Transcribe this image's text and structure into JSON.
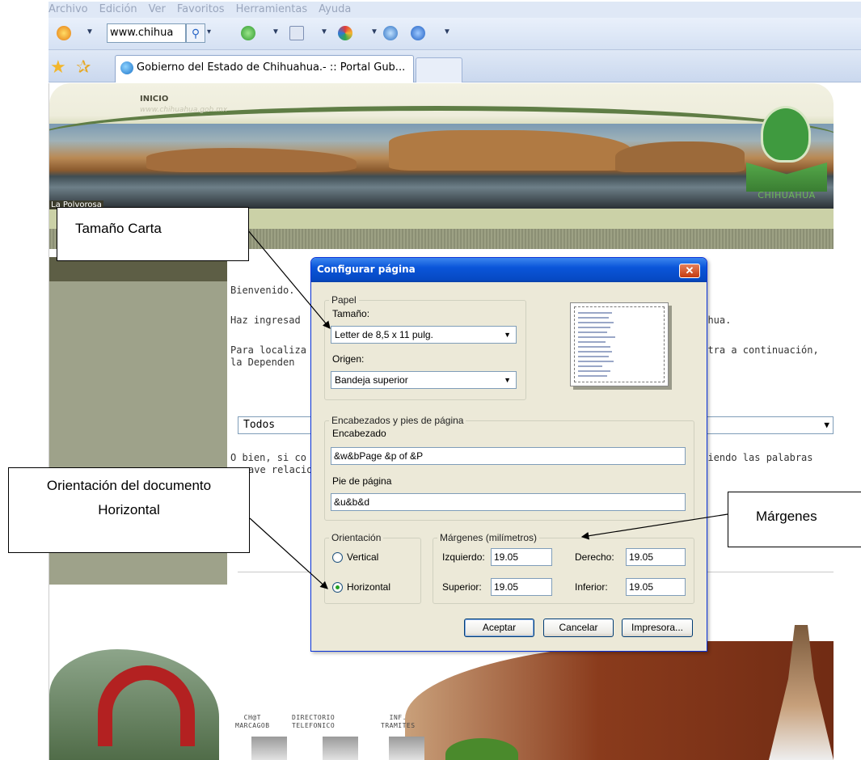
{
  "browser": {
    "menu": [
      "Archivo",
      "Edición",
      "Ver",
      "Favoritos",
      "Herramientas",
      "Ayuda"
    ],
    "address": "www.chihua",
    "tab_title": "Gobierno del Estado de Chihuahua.- :: Portal Gub..."
  },
  "webpage": {
    "inicio": "INICIO",
    "site_url": "www.chihuahua.gob.mx",
    "photo_caption": "La Polvorosa",
    "seal_text": "CHIHUAHUA",
    "content": {
      "bienvenido": "Bienvenido.",
      "haz_ingresado": "Haz ingresad",
      "haz_ingresado_right": "uahua.",
      "para_localizar": "Para localiza",
      "para_localizar_right": "estra a continuación,",
      "la_dependencia": "la Dependen",
      "select_value": "Todos",
      "obien": "O bien, si co",
      "obien_right": "uciendo las palabras",
      "clave": "ave relacio"
    },
    "footer_links": [
      {
        "line1": "CH@T",
        "line2": "MARCAGOB"
      },
      {
        "line1": "DIRECTORIO",
        "line2": "TELEFONICO"
      },
      {
        "line1": "INF.",
        "line2": "TRAMITES"
      }
    ]
  },
  "dialog": {
    "title": "Configurar página",
    "close": "✕",
    "papel": {
      "legend": "Papel",
      "tamano_label": "Tamaño:",
      "tamano_value": "Letter de 8,5 x 11 pulg.",
      "origen_label": "Origen:",
      "origen_value": "Bandeja superior"
    },
    "encabezados": {
      "legend": "Encabezados y pies de página",
      "encabezado_label": "Encabezado",
      "encabezado_value": "&w&bPage &p of &P",
      "pie_label": "Pie de página",
      "pie_value": "&u&b&d"
    },
    "orientacion": {
      "legend": "Orientación",
      "vertical": "Vertical",
      "horizontal": "Horizontal",
      "selected": "Horizontal"
    },
    "margenes": {
      "legend": "Márgenes (milímetros)",
      "izquierdo_label": "Izquierdo:",
      "izquierdo_value": "19.05",
      "derecho_label": "Derecho:",
      "derecho_value": "19.05",
      "superior_label": "Superior:",
      "superior_value": "19.05",
      "inferior_label": "Inferior:",
      "inferior_value": "19.05"
    },
    "buttons": {
      "aceptar": "Aceptar",
      "cancelar": "Cancelar",
      "impresora": "Impresora..."
    }
  },
  "callouts": {
    "tamano_carta": "Tamaño Carta",
    "orientacion_line1": "Orientación del documento",
    "orientacion_line2": "Horizontal",
    "margenes": "Márgenes"
  }
}
